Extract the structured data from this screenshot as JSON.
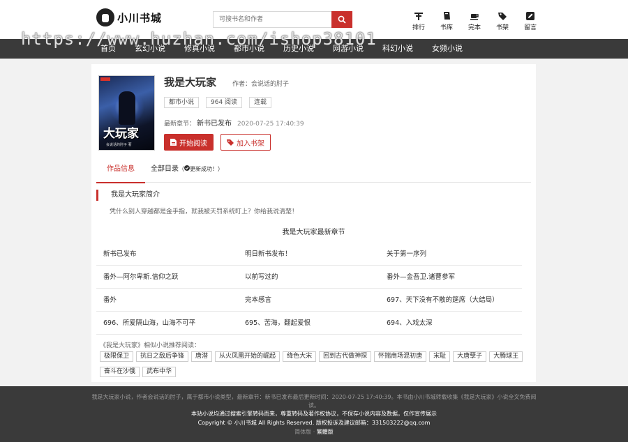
{
  "site": {
    "logo_text": "小川书城"
  },
  "search": {
    "placeholder": "可搜书名和作者"
  },
  "topnav": [
    {
      "label": "排行",
      "icon": "ranking-icon"
    },
    {
      "label": "书库",
      "icon": "library-icon"
    },
    {
      "label": "完本",
      "icon": "cup-icon"
    },
    {
      "label": "书架",
      "icon": "tag-icon"
    },
    {
      "label": "留言",
      "icon": "edit-icon"
    }
  ],
  "mainnav": [
    "首页",
    "玄幻小说",
    "修真小说",
    "都市小说",
    "历史小说",
    "网游小说",
    "科幻小说",
    "女频小说"
  ],
  "watermark": "https://www.huzhan.com/ishop38101",
  "book": {
    "title": "我是大玩家",
    "author": "作者：会说话的肘子",
    "cover_title": "大玩家",
    "cover_small": "我是",
    "cover_author": "会说话的肘子 著",
    "tags": [
      "都市小说",
      "964 阅读",
      "连载"
    ],
    "latest_label": "最新章节：",
    "latest_title": "新书已发布",
    "latest_date": "2020-07-25 17:40:39",
    "read_btn": "开始阅读",
    "shelf_btn": "加入书架"
  },
  "tabs": {
    "info": "作品信息",
    "catalog": "全部目录",
    "catalog_note": "（",
    "catalog_note2": "更新成功！）"
  },
  "intro": {
    "heading": "我是大玩家简介",
    "text": "凭什么别人穿越都是金手指，就我被天罚系统盯上？你给我说清楚！"
  },
  "chapters": {
    "heading": "我是大玩家最新章节",
    "rows": [
      [
        "新书已发布",
        "明日新书发布！",
        "关于第一序列"
      ],
      [
        "番外—阿尔卑斯.信仰之跃",
        "以前写过的",
        "番外—金吾卫.诸曹参军"
      ],
      [
        "番外",
        "完本感言",
        "697、天下没有不散的筵席（大结局）"
      ],
      [
        "696、所爱隔山海，山海不可平",
        "695、苦海，翻起爱恨",
        "694、入戏太深"
      ]
    ]
  },
  "similar": {
    "heading": "《我是大玩家》相似小说推荐阅读：",
    "items": [
      "极限保卫",
      "抗日之敌后争锋",
      "唐潜",
      "从火凤凰开始的崛起",
      "绛色大宋",
      "回到古代做神探",
      "怀揣商场混初唐",
      "宋耻",
      "大唐孽子",
      "大腾球王",
      "奋斗在沙俄",
      "武布中华"
    ]
  },
  "footer": {
    "line1": "我是大玩家小说，作者会说话的肘子，属于都市小说类型，最新章节：新书已发布最后更新时间：2020-07-25 17:40:39。本书由小川书城转载收集《我是大玩家》小说全文免费阅读。",
    "line2": "本站小说均通过搜索引擎转码而来，尊重转码及著作权协议，不保存小说内容及数据，仅作宣传展示",
    "line3": "Copyright © 小川书城 All Rights Reserved. 版权投诉及建议邮箱：331503222@qq.com",
    "lang_simplified": "简体版",
    "lang_sep": " · ",
    "lang_traditional": "繁體版"
  }
}
